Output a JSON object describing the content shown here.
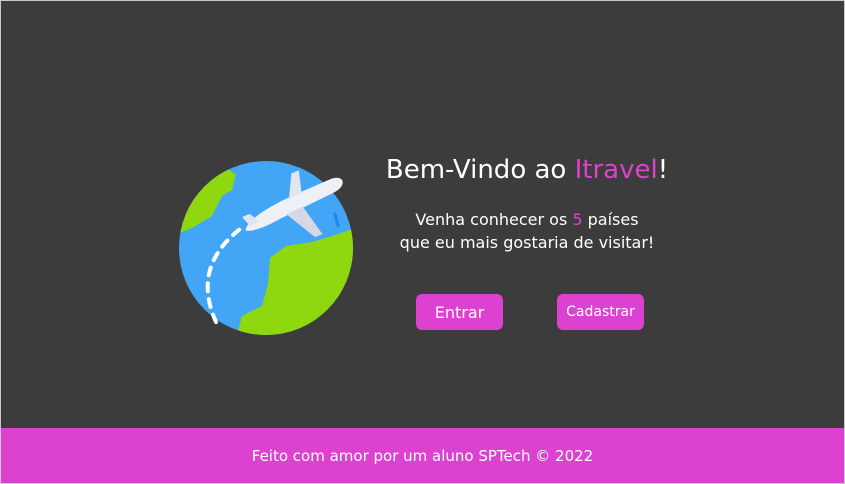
{
  "colors": {
    "background": "#3c3c3c",
    "accent": "#dc42cf",
    "text": "#ffffff",
    "globe_ocean": "#42a5f5",
    "globe_land": "#8fd80f",
    "plane": "#eef0f6"
  },
  "hero": {
    "illustration": "globe-airplane-icon",
    "welcome_prefix": "Bem-Vindo ao ",
    "welcome_brand": "Itravel",
    "welcome_suffix": "!",
    "subtitle_part1": "Venha conhecer os ",
    "subtitle_number": "5",
    "subtitle_part2": " países",
    "subtitle_line2": "que eu mais gostaria de visitar!"
  },
  "actions": {
    "enter_label": "Entrar",
    "signup_label": "Cadastrar"
  },
  "footer": {
    "text": "Feito com amor por um aluno SPTech © 2022"
  }
}
